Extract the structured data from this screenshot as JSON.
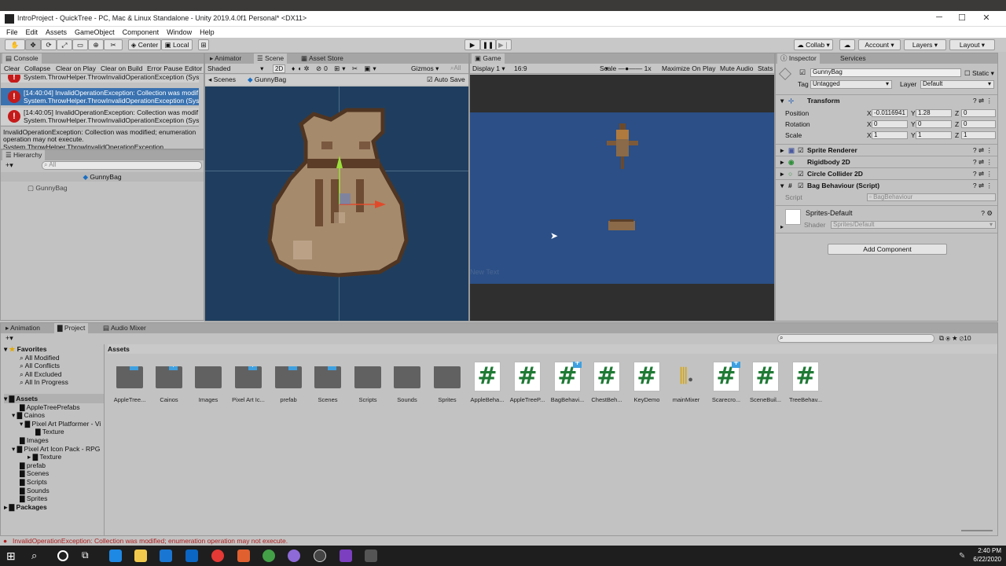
{
  "window": {
    "title": "IntroProject - QuickTree - PC, Mac & Linux Standalone - Unity 2019.4.0f1 Personal* <DX11>"
  },
  "menu": [
    "File",
    "Edit",
    "Assets",
    "GameObject",
    "Component",
    "Window",
    "Help"
  ],
  "toolbar": {
    "center": "Center",
    "local": "Local",
    "collab": "Collab",
    "account": "Account",
    "layers": "Layers",
    "layout": "Layout"
  },
  "console": {
    "tab": "Console",
    "buttons": [
      "Clear",
      "Collapse",
      "Clear on Play",
      "Clear on Build",
      "Error Pause",
      "Editor"
    ],
    "entries": [
      {
        "line1": "System.ThrowHelper.ThrowInvalidOperationException (Sys"
      },
      {
        "line1": "[14:40:04] InvalidOperationException: Collection was modif",
        "line2": "System.ThrowHelper.ThrowInvalidOperationException (Sys"
      },
      {
        "line1": "[14:40:05] InvalidOperationException: Collection was modif",
        "line2": "System.ThrowHelper.ThrowInvalidOperationException (Sys"
      }
    ],
    "detail1": "InvalidOperationException: Collection was modified; enumeration",
    "detail2": "operation may not execute.",
    "detail3": "System.ThrowHelper.ThrowInvalidOperationException"
  },
  "hierarchy": {
    "tab": "Hierarchy",
    "search": "All",
    "scene": "GunnyBag",
    "item": "GunnyBag"
  },
  "scene": {
    "tabs": [
      "Animator",
      "Scene",
      "Asset Store"
    ],
    "shading": "Shaded",
    "mode2d": "2D",
    "gizmos": "Gizmos",
    "search": "All",
    "breadcrumb_scenes": "Scenes",
    "breadcrumb_obj": "GunnyBag",
    "autosave": "Auto Save"
  },
  "game": {
    "tab": "Game",
    "display": "Display 1",
    "aspect": "16:9",
    "scale_label": "Scale",
    "scale_value": "1x",
    "maximize": "Maximize On Play",
    "mute": "Mute Audio",
    "stats": "Stats",
    "newtext": "New Text"
  },
  "inspector": {
    "tabs": [
      "Inspector",
      "Services"
    ],
    "object_name": "GunnyBag",
    "static": "Static",
    "tag_label": "Tag",
    "tag_value": "Untagged",
    "layer_label": "Layer",
    "layer_value": "Default",
    "transform": "Transform",
    "position": {
      "label": "Position",
      "x": "-0.0116941",
      "y": "1.28",
      "z": "0"
    },
    "rotation": {
      "label": "Rotation",
      "x": "0",
      "y": "0",
      "z": "0"
    },
    "scale": {
      "label": "Scale",
      "x": "1",
      "y": "1",
      "z": "1"
    },
    "components": [
      "Sprite Renderer",
      "Rigidbody 2D",
      "Circle Collider 2D",
      "Bag Behaviour (Script)"
    ],
    "script_label": "Script",
    "script_value": "BagBehaviour",
    "material": "Sprites-Default",
    "shader_label": "Shader",
    "shader_value": "Sprites/Default",
    "add_component": "Add Component"
  },
  "project": {
    "tabs": [
      "Animation",
      "Project",
      "Audio Mixer"
    ],
    "favorites": "Favorites",
    "fav_items": [
      "All Modified",
      "All Conflicts",
      "All Excluded",
      "All In Progress"
    ],
    "assets_root": "Assets",
    "tree": [
      "AppleTreePrefabs",
      "Cainos",
      "Pixel Art Platformer - Vi",
      "Texture",
      "Images",
      "Pixel Art Icon Pack - RPG",
      "Texture",
      "prefab",
      "Scenes",
      "Scripts",
      "Sounds",
      "Sprites"
    ],
    "packages": "Packages",
    "breadcrumb": "Assets",
    "count": "10",
    "folders": [
      "AppleTree...",
      "Cainos",
      "Images",
      "Pixel Art Ic...",
      "prefab",
      "Scenes",
      "Scripts",
      "Sounds",
      "Sprites"
    ],
    "scripts": [
      "AppleBeha...",
      "AppleTreeP...",
      "BagBehavi...",
      "ChestBeh...",
      "KeyDemo"
    ],
    "mixer": "mainMixer",
    "scripts2": [
      "Scarecro...",
      "SceneBuil...",
      "TreeBehav..."
    ]
  },
  "statusbar": "InvalidOperationException: Collection was modified; enumeration operation may not execute.",
  "taskbar": {
    "time": "2:40 PM",
    "date": "6/22/2020"
  },
  "colors": {
    "scene_bg": "#1f3e5f",
    "game_bg": "#2b4f86",
    "error": "#c51a1a",
    "selection": "#3a72b0"
  }
}
